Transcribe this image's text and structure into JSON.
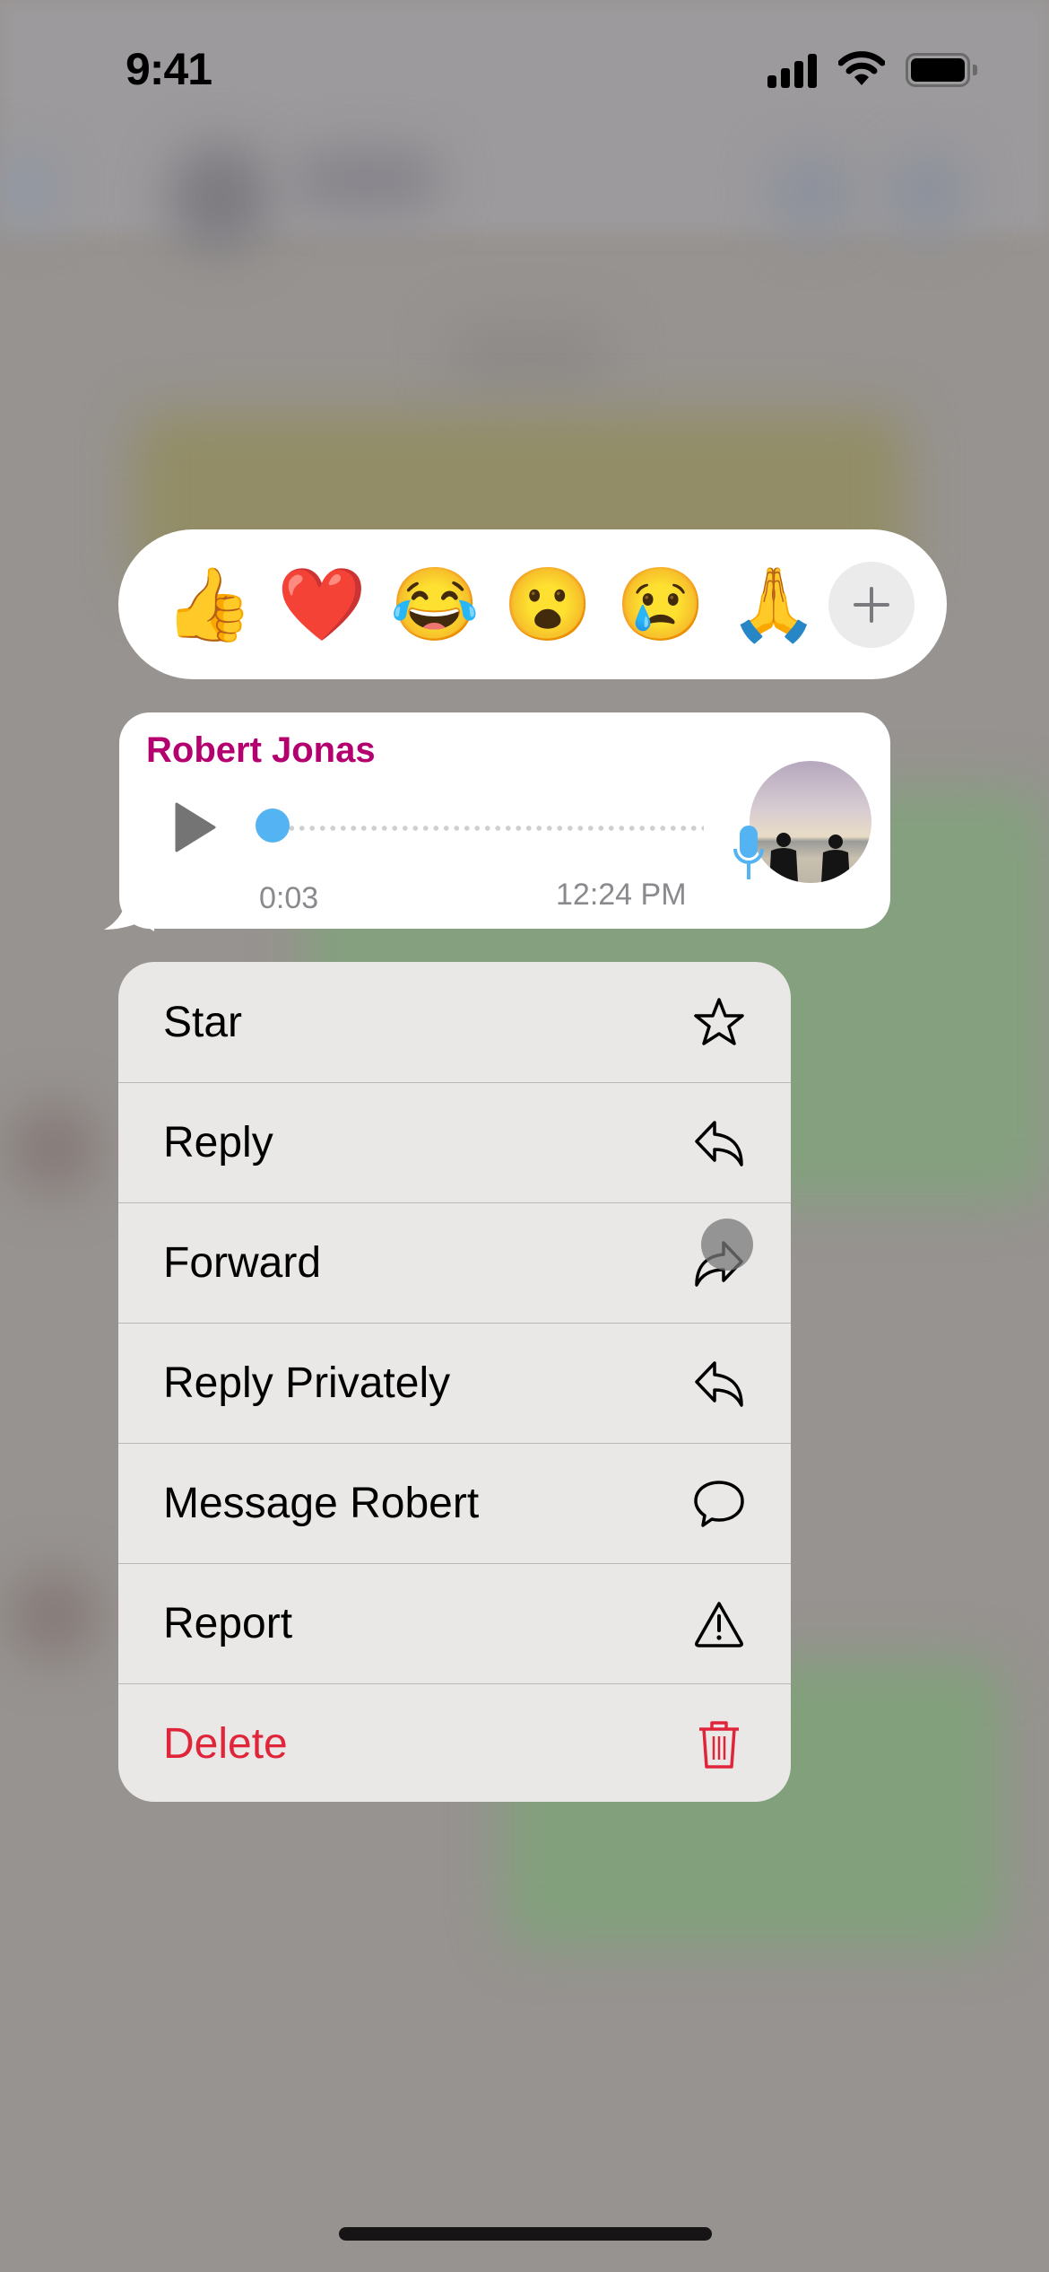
{
  "status_bar": {
    "time": "9:41",
    "signal_icon": "cellular-signal-icon",
    "wifi_icon": "wifi-icon",
    "battery_icon": "battery-full-icon"
  },
  "reactions": {
    "items": [
      {
        "name": "thumbs-up",
        "emoji": "👍"
      },
      {
        "name": "red-heart",
        "emoji": "❤️"
      },
      {
        "name": "tears-of-joy",
        "emoji": "😂"
      },
      {
        "name": "surprised",
        "emoji": "😮"
      },
      {
        "name": "crying",
        "emoji": "😢"
      },
      {
        "name": "folded-hands",
        "emoji": "🙏"
      }
    ],
    "more_icon": "plus-icon"
  },
  "message": {
    "sender": "Robert Jonas",
    "sender_color": "#b4006e",
    "type": "voice",
    "duration": "0:03",
    "progress_percent": 0,
    "timestamp": "12:24 PM",
    "accent_color": "#53b3f3"
  },
  "menu": {
    "items": [
      {
        "label": "Star",
        "icon": "star-icon",
        "destructive": false
      },
      {
        "label": "Reply",
        "icon": "reply-icon",
        "destructive": false
      },
      {
        "label": "Forward",
        "icon": "forward-icon",
        "destructive": false
      },
      {
        "label": "Reply Privately",
        "icon": "reply-privately-icon",
        "destructive": false
      },
      {
        "label": "Message Robert",
        "icon": "message-bubble-icon",
        "destructive": false
      },
      {
        "label": "Report",
        "icon": "warning-icon",
        "destructive": false
      },
      {
        "label": "Delete",
        "icon": "trash-icon",
        "destructive": true
      }
    ],
    "destructive_color": "#e0253a"
  }
}
